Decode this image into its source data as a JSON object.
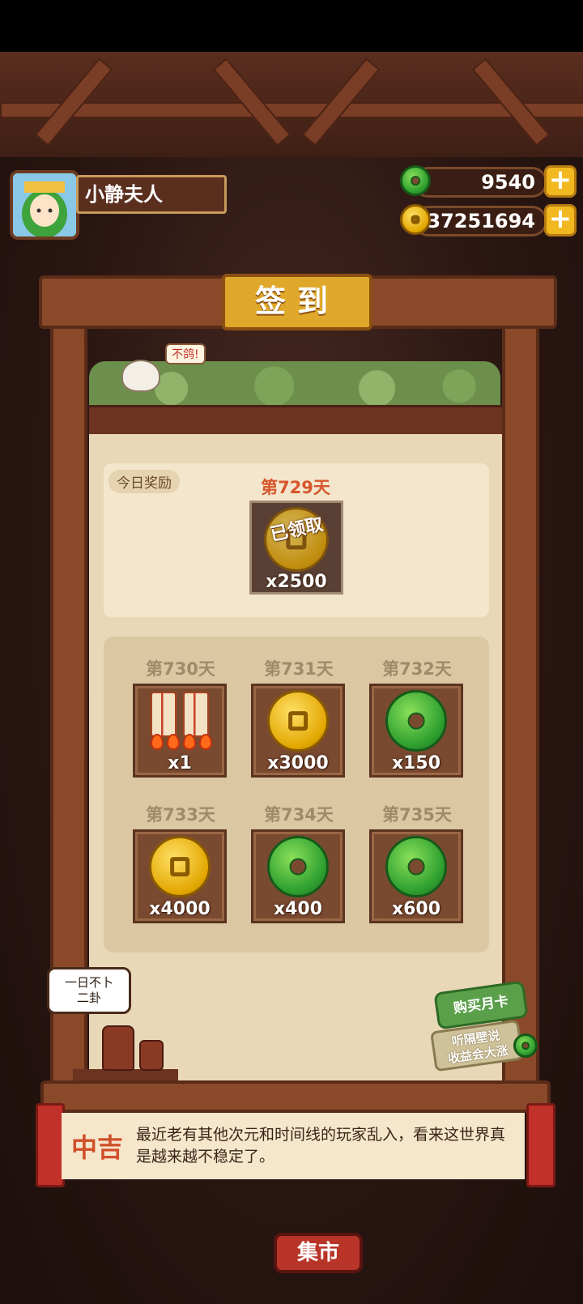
{
  "header": {
    "player_name": "小静夫人",
    "jade_amount": "9540",
    "coin_amount": "37251694"
  },
  "signin": {
    "title": "签到",
    "bird_speech": "不鸽!",
    "today": {
      "tag": "今日奖励",
      "day": "第729天",
      "status": "已领取",
      "reward_icon": "coin-icon",
      "quantity": "x2500"
    },
    "upcoming": [
      {
        "day": "第730天",
        "reward_icon": "firecracker-icon",
        "quantity": "x1"
      },
      {
        "day": "第731天",
        "reward_icon": "coin-icon",
        "quantity": "x3000"
      },
      {
        "day": "第732天",
        "reward_icon": "jade-icon",
        "quantity": "x150"
      },
      {
        "day": "第733天",
        "reward_icon": "coin-icon",
        "quantity": "x4000"
      },
      {
        "day": "第734天",
        "reward_icon": "jade-icon",
        "quantity": "x400"
      },
      {
        "day": "第735天",
        "reward_icon": "jade-icon",
        "quantity": "x600"
      }
    ],
    "speech_bubble": {
      "line1": "一日不卜",
      "line2": "二卦"
    },
    "month_card": {
      "label": "购买月卡",
      "sub_line1": "听隔壁说",
      "sub_line2": "收益会大涨"
    }
  },
  "fortune": {
    "level": "中吉",
    "text": "最近老有其他次元和时间线的玩家乱入，看来这世界真是越来越不稳定了。"
  },
  "market_label": "集市",
  "colors": {
    "accent_gold": "#e0a82a",
    "day_red": "#d7562a",
    "jade_green": "#2fa030"
  }
}
